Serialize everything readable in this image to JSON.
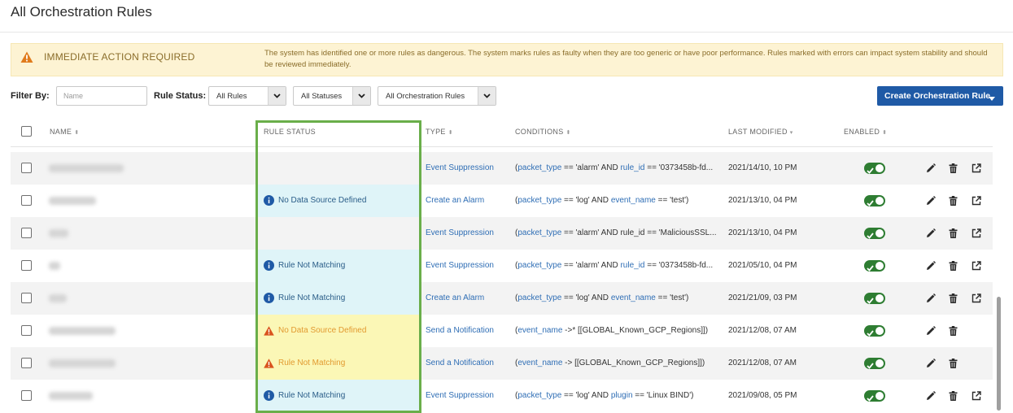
{
  "page_title": "All Orchestration Rules",
  "alert": {
    "title": "IMMEDIATE ACTION REQUIRED",
    "message": "The system has identified one or more rules as dangerous. The system marks rules as faulty when they are too generic or have poor performance. Rules marked with errors can impact system stability and should be reviewed immediately."
  },
  "filters": {
    "filter_by_label": "Filter By:",
    "name_placeholder": "Name",
    "rule_status_label": "Rule Status:",
    "rules_select": "All Rules",
    "statuses_select": "All Statuses",
    "orchestration_select": "All Orchestration Rules",
    "create_button": "Create Orchestration Rule"
  },
  "columns": {
    "name": "NAME",
    "rule_status": "RULE STATUS",
    "type": "TYPE",
    "conditions": "CONDITIONS",
    "last_modified": "LAST MODIFIED",
    "enabled": "ENABLED"
  },
  "rows": [
    {
      "status": "",
      "status_kind": "none",
      "type": "Event Suppression",
      "cond": [
        [
          "kw",
          "packet_type"
        ],
        [
          "op",
          " == 'alarm' AND "
        ],
        [
          "kw",
          "rule_id"
        ],
        [
          "op",
          " == '0373458b-fd..."
        ]
      ],
      "modified": "2021/14/10, 10 PM",
      "enabled": true,
      "share": true
    },
    {
      "status": "No Data Source Defined",
      "status_kind": "info",
      "type": "Create an Alarm",
      "cond": [
        [
          "kw",
          "packet_type"
        ],
        [
          "op",
          " == 'log' AND "
        ],
        [
          "kw",
          "event_name"
        ],
        [
          "op",
          " == 'test')"
        ]
      ],
      "modified": "2021/13/10, 04 PM",
      "enabled": true,
      "share": true
    },
    {
      "status": "",
      "status_kind": "none",
      "type": "Event Suppression",
      "cond": [
        [
          "kw",
          "packet_type"
        ],
        [
          "op",
          " == 'alarm' AND rule_id == 'MaliciousSSL..."
        ]
      ],
      "modified": "2021/13/10, 04 PM",
      "enabled": true,
      "share": true
    },
    {
      "status": "Rule Not Matching",
      "status_kind": "info",
      "type": "Event Suppression",
      "cond": [
        [
          "kw",
          "packet_type"
        ],
        [
          "op",
          " == 'alarm' AND "
        ],
        [
          "kw",
          "rule_id"
        ],
        [
          "op",
          " == '0373458b-fd..."
        ]
      ],
      "modified": "2021/05/10, 04 PM",
      "enabled": true,
      "share": true
    },
    {
      "status": "Rule Not Matching",
      "status_kind": "info",
      "type": "Create an Alarm",
      "cond": [
        [
          "kw",
          "packet_type"
        ],
        [
          "op",
          " == 'log' AND "
        ],
        [
          "kw",
          "event_name"
        ],
        [
          "op",
          " == 'test')"
        ]
      ],
      "modified": "2021/21/09, 03 PM",
      "enabled": true,
      "share": true
    },
    {
      "status": "No Data Source Defined",
      "status_kind": "warn",
      "type": "Send a Notification",
      "cond": [
        [
          "kw",
          "event_name"
        ],
        [
          "op",
          " ->* [[GLOBAL_Known_GCP_Regions]])"
        ]
      ],
      "modified": "2021/12/08, 07 AM",
      "enabled": true,
      "share": false
    },
    {
      "status": "Rule Not Matching",
      "status_kind": "warn",
      "type": "Send a Notification",
      "cond": [
        [
          "kw",
          "event_name"
        ],
        [
          "op",
          " -> [[GLOBAL_Known_GCP_Regions]])"
        ]
      ],
      "modified": "2021/12/08, 07 AM",
      "enabled": true,
      "share": false
    },
    {
      "status": "Rule Not Matching",
      "status_kind": "info",
      "type": "Event Suppression",
      "cond": [
        [
          "kw",
          "packet_type"
        ],
        [
          "op",
          " == 'log' AND "
        ],
        [
          "kw",
          "plugin"
        ],
        [
          "op",
          " == 'Linux BIND')"
        ]
      ],
      "modified": "2021/09/08, 05 PM",
      "enabled": true,
      "share": true
    }
  ],
  "colors": {
    "accent": "#1f5aa6",
    "link": "#2f6eb5",
    "toggle_on": "#2e7d32",
    "info_bg": "#dff4f8",
    "warn_bg": "#fbf7b6",
    "highlight": "#6aae4a"
  }
}
